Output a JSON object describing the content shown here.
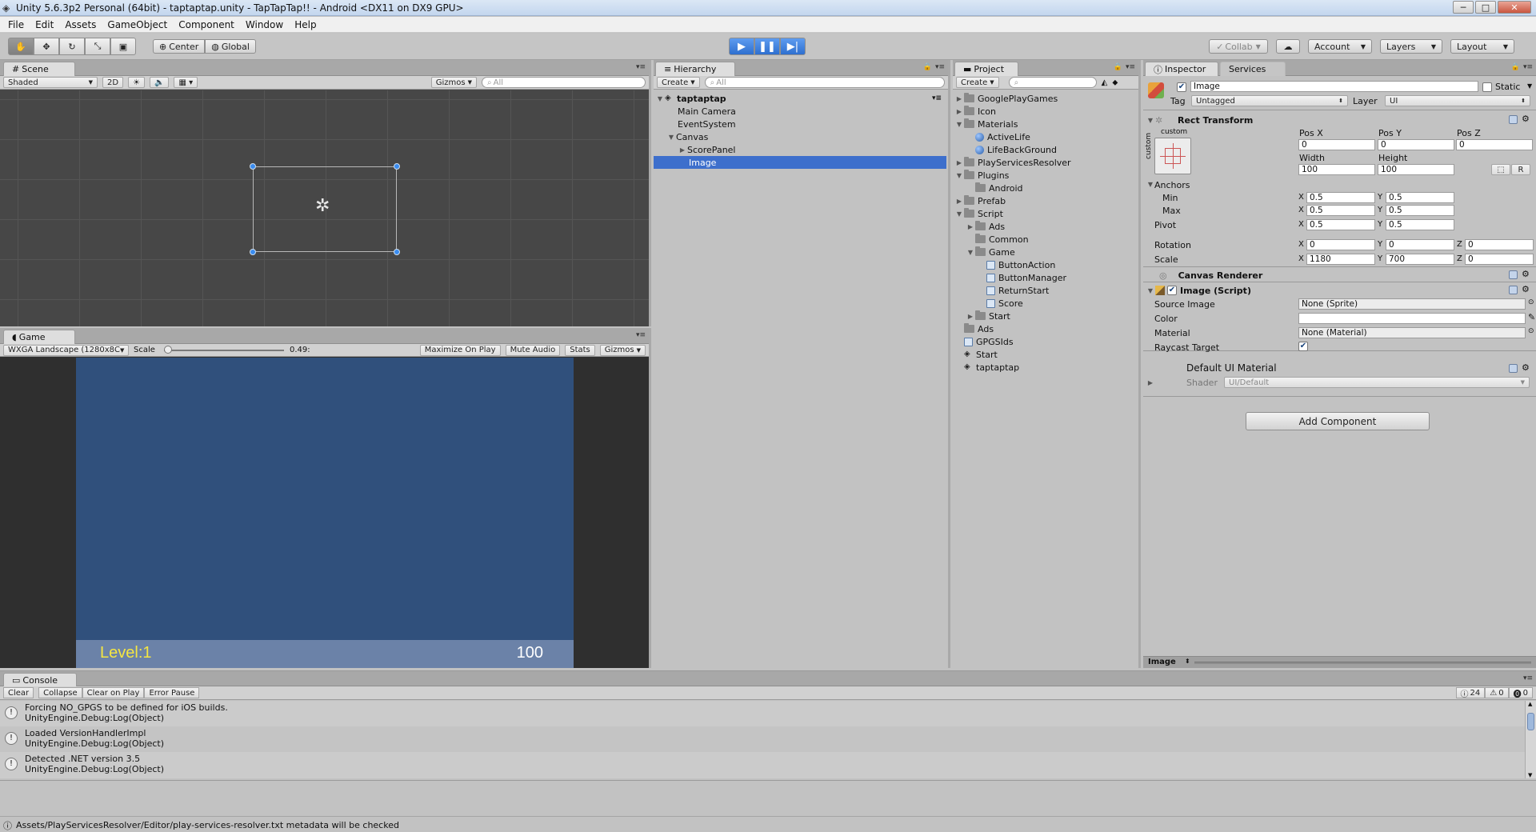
{
  "window": {
    "title": "Unity 5.6.3p2 Personal (64bit) - taptaptap.unity - TapTapTap!! - Android <DX11 on DX9 GPU>"
  },
  "menu": [
    "File",
    "Edit",
    "Assets",
    "GameObject",
    "Component",
    "Window",
    "Help"
  ],
  "toolbar": {
    "center_label": "Center",
    "global_label": "Global",
    "collab_label": "Collab",
    "account_label": "Account",
    "layers_label": "Layers",
    "layout_label": "Layout"
  },
  "scene": {
    "tab": "Scene",
    "shading": "Shaded",
    "mode_2d": "2D",
    "gizmos": "Gizmos",
    "search_placeholder": "All"
  },
  "game": {
    "tab": "Game",
    "resolution": "WXGA Landscape (1280x8C",
    "scale_label": "Scale",
    "scale_value": "0.49:",
    "scale_fraction": 0.0,
    "maximize": "Maximize On Play",
    "mute": "Mute Audio",
    "stats": "Stats",
    "gizmos": "Gizmos",
    "level_text": "Level:1",
    "score_text": "100",
    "bg_color": "#30507c",
    "bar_color": "#6b82a8"
  },
  "hierarchy": {
    "tab": "Hierarchy",
    "create": "Create",
    "search_placeholder": "All",
    "scene_name": "taptaptap",
    "items": [
      "Main Camera",
      "EventSystem",
      "Canvas",
      "ScorePanel",
      "Image"
    ]
  },
  "project": {
    "tab": "Project",
    "create": "Create",
    "items": [
      "GooglePlayGames",
      "Icon",
      "Materials",
      "ActiveLife",
      "LifeBackGround",
      "PlayServicesResolver",
      "Plugins",
      "Android",
      "Prefab",
      "Script",
      "Ads",
      "Common",
      "Game",
      "ButtonAction",
      "ButtonManager",
      "ReturnStart",
      "Score",
      "Start",
      "Ads",
      "GPGSIds",
      "Start",
      "taptaptap"
    ]
  },
  "inspector": {
    "tab": "Inspector",
    "services_tab": "Services",
    "object_name": "Image",
    "static_label": "Static",
    "tag_label": "Tag",
    "tag_value": "Untagged",
    "layer_label": "Layer",
    "layer_value": "UI",
    "rect": {
      "title": "Rect Transform",
      "anchor_preset": "custom",
      "side_label": "custom",
      "posx_label": "Pos X",
      "posy_label": "Pos Y",
      "posz_label": "Pos Z",
      "posx": "0",
      "posy": "0",
      "posz": "0",
      "width_label": "Width",
      "height_label": "Height",
      "width": "100",
      "height": "100",
      "r_btn": "R",
      "anchors_label": "Anchors",
      "min_label": "Min",
      "max_label": "Max",
      "pivot_label": "Pivot",
      "min_x": "0.5",
      "min_y": "0.5",
      "max_x": "0.5",
      "max_y": "0.5",
      "pivot_x": "0.5",
      "pivot_y": "0.5",
      "rotation_label": "Rotation",
      "rot_x": "0",
      "rot_y": "0",
      "rot_z": "0",
      "scale_label": "Scale",
      "scale_x": "1180",
      "scale_y": "700",
      "scale_z": "0",
      "x": "X",
      "y": "Y",
      "z": "Z"
    },
    "canvas_renderer": "Canvas Renderer",
    "image_script": {
      "title": "Image (Script)",
      "source_label": "Source Image",
      "source_value": "None (Sprite)",
      "color_label": "Color",
      "material_label": "Material",
      "material_value": "None (Material)",
      "raycast_label": "Raycast Target"
    },
    "material": {
      "title": "Default UI Material",
      "shader_label": "Shader",
      "shader_value": "UI/Default"
    },
    "add_component": "Add Component",
    "footer": "Image"
  },
  "console": {
    "tab": "Console",
    "clear": "Clear",
    "collapse": "Collapse",
    "clear_on_play": "Clear on Play",
    "error_pause": "Error Pause",
    "count_log": "24",
    "count_warn": "0",
    "count_error": "0",
    "entries": [
      {
        "line1": "Forcing NO_GPGS to be defined for iOS builds.",
        "line2": "UnityEngine.Debug:Log(Object)"
      },
      {
        "line1": "Loaded VersionHandlerImpl",
        "line2": "UnityEngine.Debug:Log(Object)"
      },
      {
        "line1": "Detected .NET version 3.5",
        "line2": "UnityEngine.Debug:Log(Object)"
      }
    ]
  },
  "status": {
    "text": "Assets/PlayServicesResolver/Editor/play-services-resolver.txt metadata will be checked"
  },
  "colors": {
    "accent": "#3d7bd6",
    "selection": "#3d6fcc",
    "game_text": "#f5e642"
  }
}
